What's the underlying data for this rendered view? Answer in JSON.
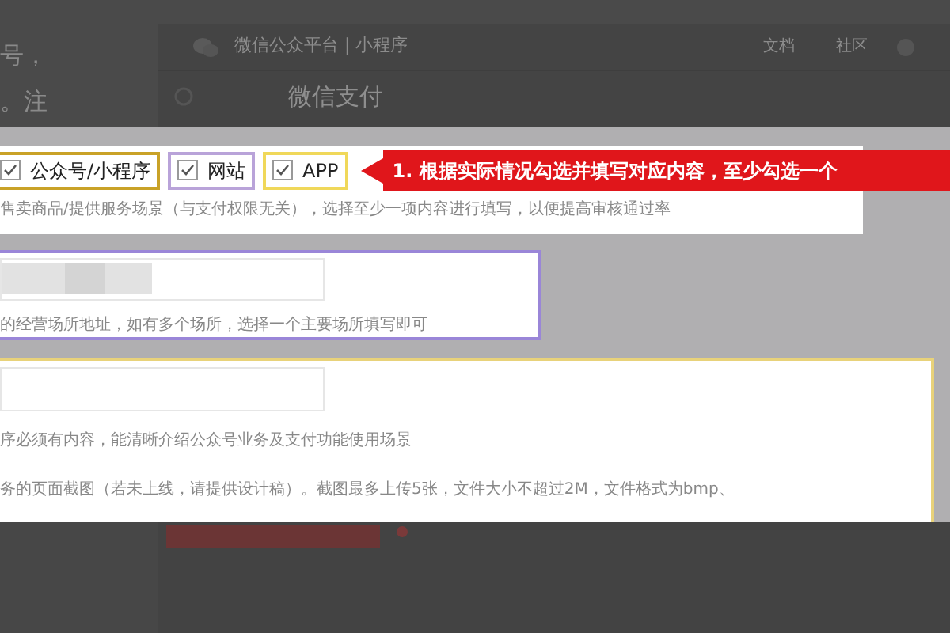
{
  "background_page": {
    "left_text": [
      "号，",
      "。注"
    ],
    "header": {
      "title": "微信公众平台 | 小程序",
      "links": [
        "文档",
        "社区"
      ]
    },
    "page_title": "微信支付"
  },
  "form": {
    "scene_options": [
      {
        "label": "公众号/小程序",
        "checked": true,
        "color": "#c9a227"
      },
      {
        "label": "网站",
        "checked": true,
        "color": "#b9a3d9"
      },
      {
        "label": "APP",
        "checked": true,
        "color": "#f0d85a"
      }
    ],
    "callout": "1. 根据实际情况勾选并填写对应内容，至少勾选一个",
    "scene_hint": "售卖商品/提供服务场景（与支付权限无关），选择至少一项内容进行填写，以便提高审核通过率",
    "address_hint": "的经营场所地址，如有多个场所，选择一个主要场所填写即可",
    "app_hint": "序必须有内容，能清晰介绍公众号业务及支付功能使用场景",
    "screenshot_hint": "务的页面截图（若未上线，请提供设计稿）。截图最多上传5张，文件大小不超过2M，文件格式为bmp、"
  }
}
